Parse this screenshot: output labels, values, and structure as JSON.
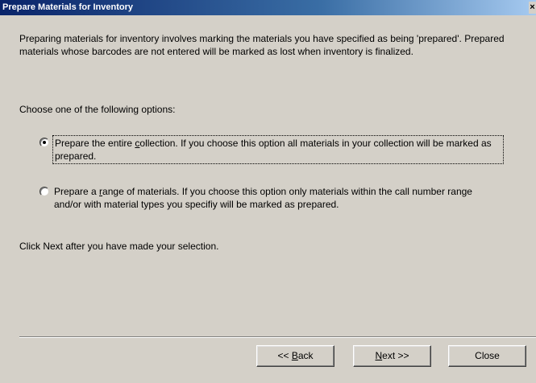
{
  "window": {
    "title": "Prepare Materials for Inventory",
    "close_glyph": "×"
  },
  "intro": {
    "text": "Preparing materials for inventory involves marking the materials you have specified as being 'prepared'.  Prepared materials whose barcodes are not entered will be marked as lost when inventory is finalized."
  },
  "choose_label": "Choose one of the following options:",
  "options": [
    {
      "pre": "Prepare the entire ",
      "mnemonic": "c",
      "post": "ollection.  If you choose this option all materials in your collection will be marked as prepared.",
      "selected": true
    },
    {
      "pre": "Prepare a ",
      "mnemonic": "r",
      "post": "ange of materials.  If you choose this option only materials within the call number range and/or with material types you specifiy will be marked as prepared.",
      "selected": false
    }
  ],
  "hint": "Click Next after you have made your selection.",
  "buttons": {
    "back": {
      "pre": "<< ",
      "mnemonic": "B",
      "post": "ack"
    },
    "next": {
      "pre": "",
      "mnemonic": "N",
      "post": "ext >>"
    },
    "close": {
      "label": "Close"
    }
  }
}
